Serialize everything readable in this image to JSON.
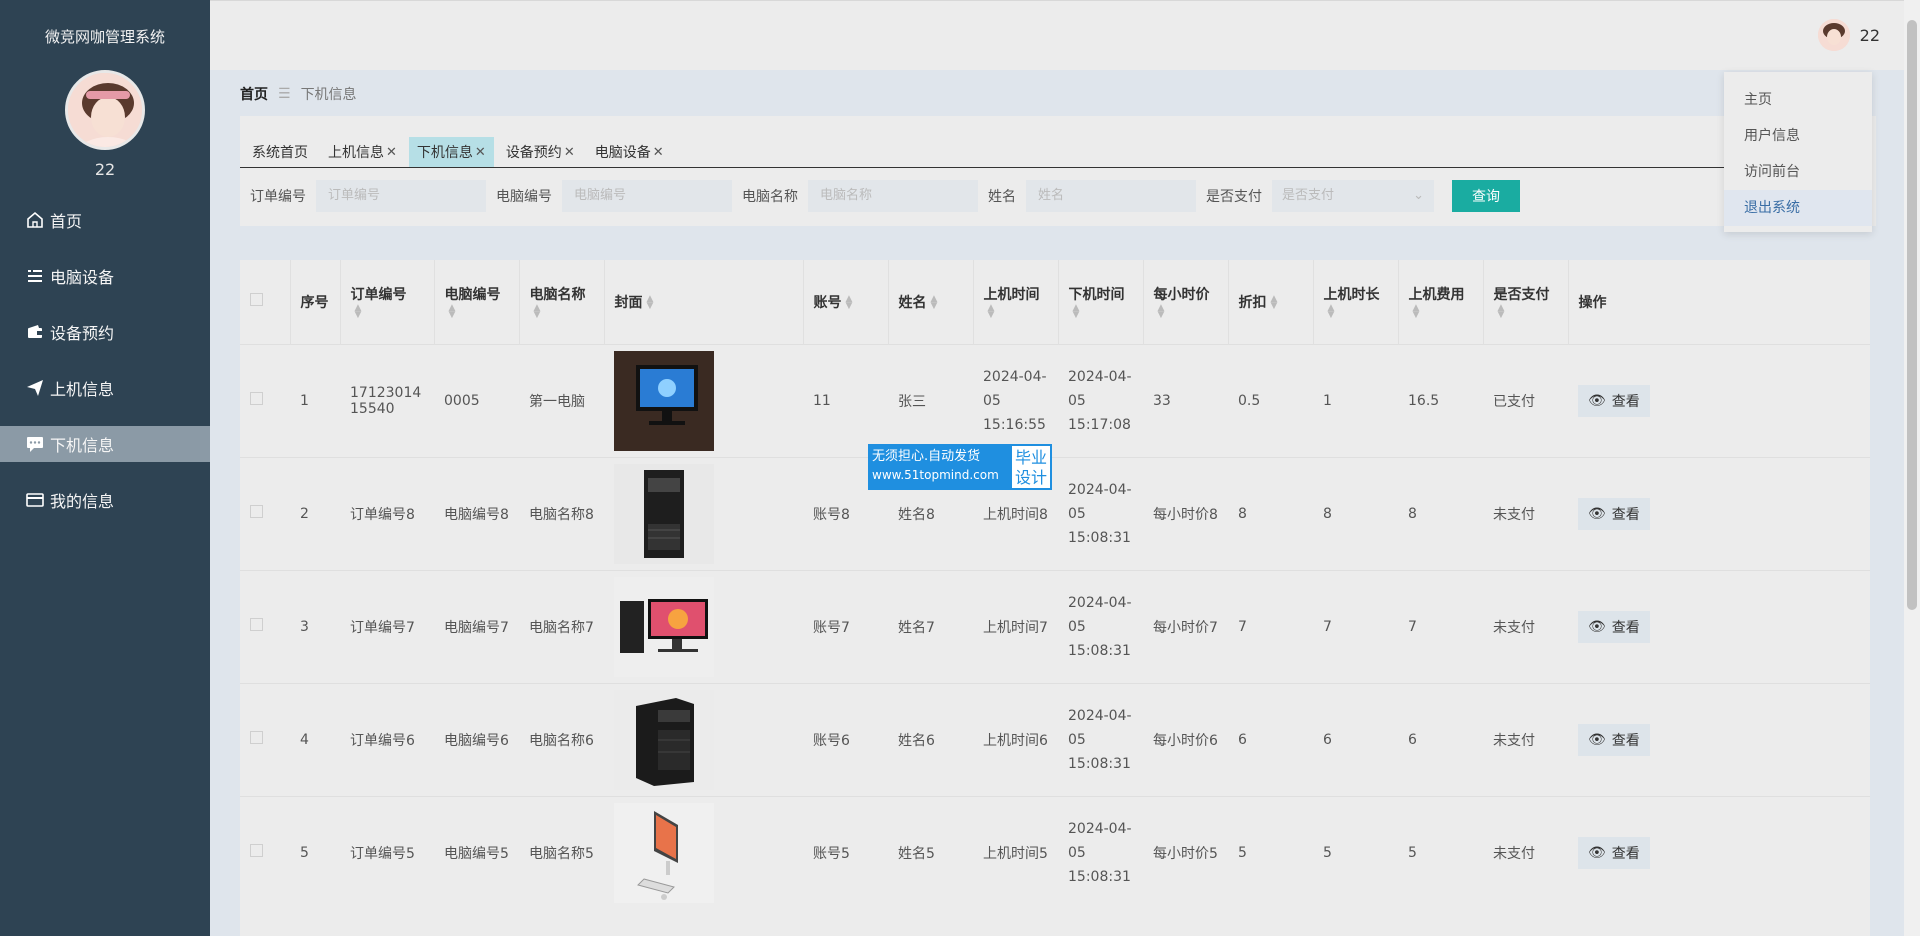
{
  "sidebar": {
    "title": "微竞网咖管理系统",
    "username": "22",
    "items": [
      {
        "label": "首页",
        "icon": "home-icon"
      },
      {
        "label": "电脑设备",
        "icon": "list-icon"
      },
      {
        "label": "设备预约",
        "icon": "wallet-icon"
      },
      {
        "label": "上机信息",
        "icon": "send-icon"
      },
      {
        "label": "下机信息",
        "icon": "chat-icon"
      },
      {
        "label": "我的信息",
        "icon": "card-icon"
      }
    ],
    "active_index": 4
  },
  "topbar": {
    "username": "22"
  },
  "dropdown": {
    "items": [
      "主页",
      "用户信息",
      "访问前台",
      "退出系统"
    ],
    "hover_index": 3
  },
  "breadcrumb": {
    "home": "首页",
    "current": "下机信息"
  },
  "tabs": [
    {
      "label": "系统首页",
      "closable": false
    },
    {
      "label": "上机信息",
      "closable": true
    },
    {
      "label": "下机信息",
      "closable": true,
      "active": true
    },
    {
      "label": "设备预约",
      "closable": true
    },
    {
      "label": "电脑设备",
      "closable": true
    }
  ],
  "filters": {
    "order_label": "订单编号",
    "order_placeholder": "订单编号",
    "pc_no_label": "电脑编号",
    "pc_no_placeholder": "电脑编号",
    "pc_name_label": "电脑名称",
    "pc_name_placeholder": "电脑名称",
    "name_label": "姓名",
    "name_placeholder": "姓名",
    "paid_label": "是否支付",
    "paid_placeholder": "是否支付",
    "query_button": "查询"
  },
  "table": {
    "headers": [
      "序号",
      "订单编号",
      "电脑编号",
      "电脑名称",
      "封面",
      "账号",
      "姓名",
      "上机时间",
      "下机时间",
      "每小时价",
      "折扣",
      "上机时长",
      "上机费用",
      "是否支付",
      "操作"
    ],
    "view_label": "查看",
    "rows": [
      {
        "no": "1",
        "order": "1712301415540",
        "pc_no": "0005",
        "pc_name": "第一电脑",
        "account": "11",
        "name": "张三",
        "on_time": "2024-04-05 15:16:55",
        "off_time": "2024-04-05 15:17:08",
        "price": "33",
        "discount": "0.5",
        "duration": "1",
        "fee": "16.5",
        "paid": "已支付"
      },
      {
        "no": "2",
        "order": "订单编号8",
        "pc_no": "电脑编号8",
        "pc_name": "电脑名称8",
        "account": "账号8",
        "name": "姓名8",
        "on_time": "上机时间8",
        "off_time": "2024-04-05 15:08:31",
        "price": "每小时价8",
        "discount": "8",
        "duration": "8",
        "fee": "8",
        "paid": "未支付"
      },
      {
        "no": "3",
        "order": "订单编号7",
        "pc_no": "电脑编号7",
        "pc_name": "电脑名称7",
        "account": "账号7",
        "name": "姓名7",
        "on_time": "上机时间7",
        "off_time": "2024-04-05 15:08:31",
        "price": "每小时价7",
        "discount": "7",
        "duration": "7",
        "fee": "7",
        "paid": "未支付"
      },
      {
        "no": "4",
        "order": "订单编号6",
        "pc_no": "电脑编号6",
        "pc_name": "电脑名称6",
        "account": "账号6",
        "name": "姓名6",
        "on_time": "上机时间6",
        "off_time": "2024-04-05 15:08:31",
        "price": "每小时价6",
        "discount": "6",
        "duration": "6",
        "fee": "6",
        "paid": "未支付"
      },
      {
        "no": "5",
        "order": "订单编号5",
        "pc_no": "电脑编号5",
        "pc_name": "电脑名称5",
        "account": "账号5",
        "name": "姓名5",
        "on_time": "上机时间5",
        "off_time": "2024-04-05 15:08:31",
        "price": "每小时价5",
        "discount": "5",
        "duration": "5",
        "fee": "5",
        "paid": "未支付"
      }
    ]
  },
  "watermark": {
    "line1": "无须担心.自动发货",
    "line2": "www.51topmind.com",
    "badge": "毕业设计"
  },
  "colors": {
    "sidebar": "#2e4353",
    "accent": "#1aaca1",
    "active_tab": "#b6dfe6"
  }
}
